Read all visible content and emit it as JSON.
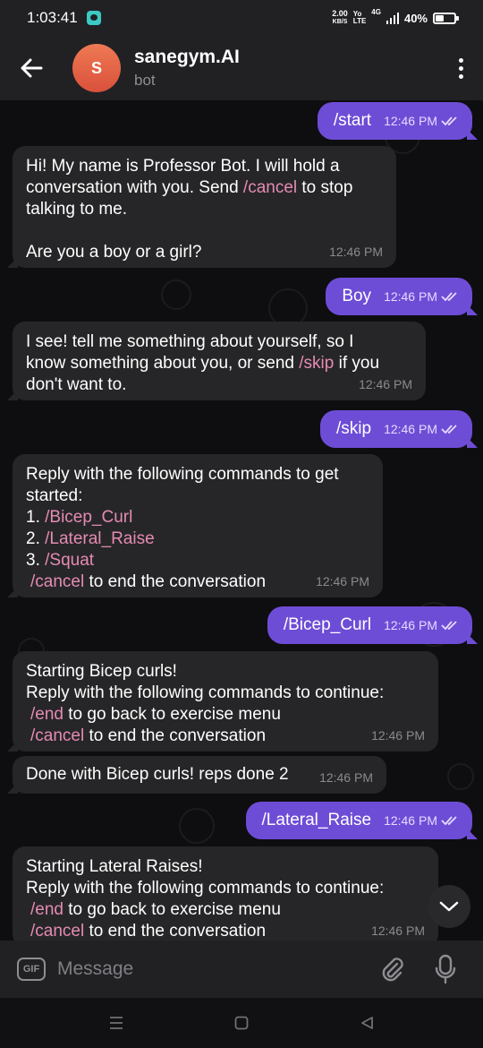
{
  "status": {
    "time": "1:03:41",
    "speed_top": "2.00",
    "speed_bottom": "KB/S",
    "network": "4G",
    "battery": "40%"
  },
  "header": {
    "avatar_letter": "S",
    "title": "sanegym.AI",
    "subtitle": "bot"
  },
  "messages": [
    {
      "from": "out",
      "text": "/start",
      "time": "12:46 PM"
    },
    {
      "from": "in",
      "text_a": "Hi! My name is Professor Bot. I will hold a",
      "text_b": "conversation with you. Send ",
      "cmd": "/cancel",
      "text_c": " to stop",
      "text_d": "talking to me.",
      "text_e": "Are you a boy or a girl?",
      "time": "12:46 PM"
    },
    {
      "from": "out",
      "text": "Boy",
      "time": "12:46 PM"
    },
    {
      "from": "in",
      "text_a": "I see! tell me something about yourself, so I",
      "text_b": "know something about you, or send ",
      "cmd": "/skip",
      "text_c": " if you",
      "text_d": "don't want to.",
      "time": "12:46 PM"
    },
    {
      "from": "out",
      "text": "/skip",
      "time": "12:46 PM"
    },
    {
      "from": "in",
      "text_a": "Reply with the following commands to get",
      "text_b": "started:",
      "item1_num": "1. ",
      "item1_cmd": "/Bicep_Curl",
      "item2_num": "2. ",
      "item2_cmd": "/Lateral_Raise",
      "item3_num": "3. ",
      "item3_cmd": "/Squat",
      "end_cmd": "/cancel",
      "end_text": " to end the conversation",
      "time": "12:46 PM"
    },
    {
      "from": "out",
      "text": "/Bicep_Curl",
      "time": "12:46 PM"
    },
    {
      "from": "in",
      "text_a": "Starting Bicep curls!",
      "text_b": "Reply with the following commands to continue:",
      "cmd1": "/end",
      "text_c": " to go back to exercise menu",
      "cmd2": "/cancel",
      "text_d": " to end the conversation",
      "time": "12:46 PM"
    },
    {
      "from": "in",
      "text_a": "Done with Bicep curls! reps done 2",
      "time": "12:46 PM"
    },
    {
      "from": "out",
      "text": "/Lateral_Raise",
      "time": "12:46 PM"
    },
    {
      "from": "in",
      "text_a": "Starting Lateral Raises!",
      "text_b": "Reply with the following commands to continue:",
      "cmd1": "/end",
      "text_c": " to go back to exercise menu",
      "cmd2": "/cancel",
      "text_d": " to end the conversation",
      "time": "12:46 PM"
    }
  ],
  "input": {
    "gif_label": "GIF",
    "placeholder": "Message"
  },
  "icons": {
    "back": "arrow-left-icon",
    "menu": "more-vertical-icon",
    "scroll": "chevron-down-icon",
    "attach": "paperclip-icon",
    "mic": "microphone-icon"
  },
  "colors": {
    "outgoing_bubble": "#6e4dd6",
    "incoming_bubble": "#262628",
    "command_link": "#e58bb3",
    "avatar": "#e26644"
  }
}
